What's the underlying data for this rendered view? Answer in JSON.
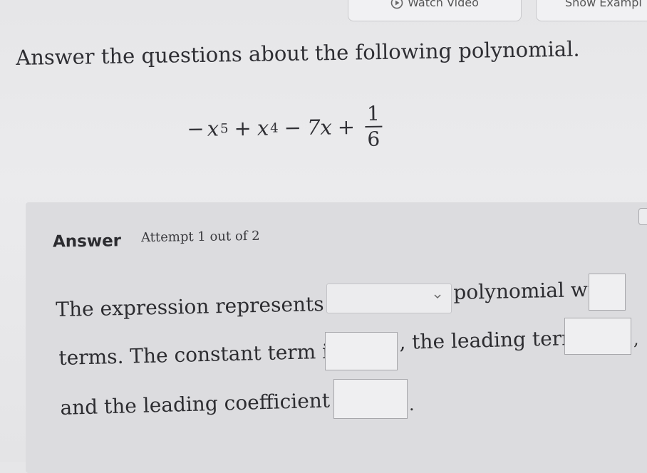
{
  "top_buttons": {
    "watch_video": "Watch Video",
    "show_example": "Show Exampl"
  },
  "question": {
    "prompt": "Answer the questions about the following polynomial.",
    "formula": {
      "t1_neg": "−",
      "t1_var": "x",
      "t1_exp": "5",
      "op1": "+",
      "t2_var": "x",
      "t2_exp": "4",
      "op2": "−",
      "t3": "7x",
      "op3": "+",
      "frac_num": "1",
      "frac_den": "6"
    }
  },
  "answer": {
    "heading": "Answer",
    "attempt": "Attempt 1 out of 2",
    "line1": "The expression represents a",
    "line1b": "polynomial with",
    "line2": "terms. The constant term is",
    "line2b": ", the leading term is",
    "line3": "and the leading coefficient is",
    "comma": ",",
    "period": "."
  }
}
